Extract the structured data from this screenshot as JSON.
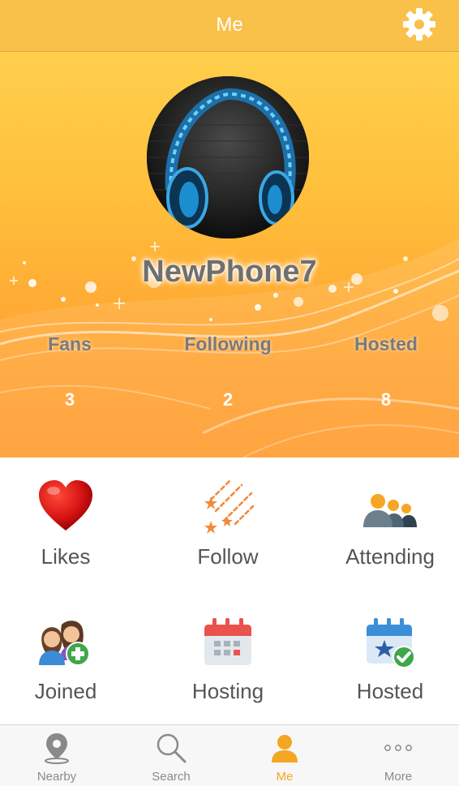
{
  "navbar": {
    "title": "Me",
    "settings_icon": "gear-icon"
  },
  "profile": {
    "username": "NewPhone7",
    "avatar_icon": "headphones-avatar",
    "stats": [
      {
        "label": "Fans",
        "value": "3"
      },
      {
        "label": "Following",
        "value": "2"
      },
      {
        "label": "Hosted",
        "value": "8"
      }
    ]
  },
  "grid": [
    {
      "label": "Likes",
      "icon": "heart-icon"
    },
    {
      "label": "Follow",
      "icon": "shooting-stars-icon"
    },
    {
      "label": "Attending",
      "icon": "group-people-icon"
    },
    {
      "label": "Joined",
      "icon": "add-friends-icon"
    },
    {
      "label": "Hosting",
      "icon": "calendar-icon"
    },
    {
      "label": "Hosted",
      "icon": "calendar-star-check-icon"
    }
  ],
  "tabbar": {
    "items": [
      {
        "label": "Nearby",
        "icon": "location-pin-icon"
      },
      {
        "label": "Search",
        "icon": "search-icon"
      },
      {
        "label": "Me",
        "icon": "person-icon"
      },
      {
        "label": "More",
        "icon": "more-dots-icon"
      }
    ],
    "active": "Me"
  },
  "colors": {
    "accent": "#f5a623",
    "navbar": "#f9c04a",
    "header_top": "#ffcf4c",
    "header_bottom": "#ff9a2c"
  }
}
